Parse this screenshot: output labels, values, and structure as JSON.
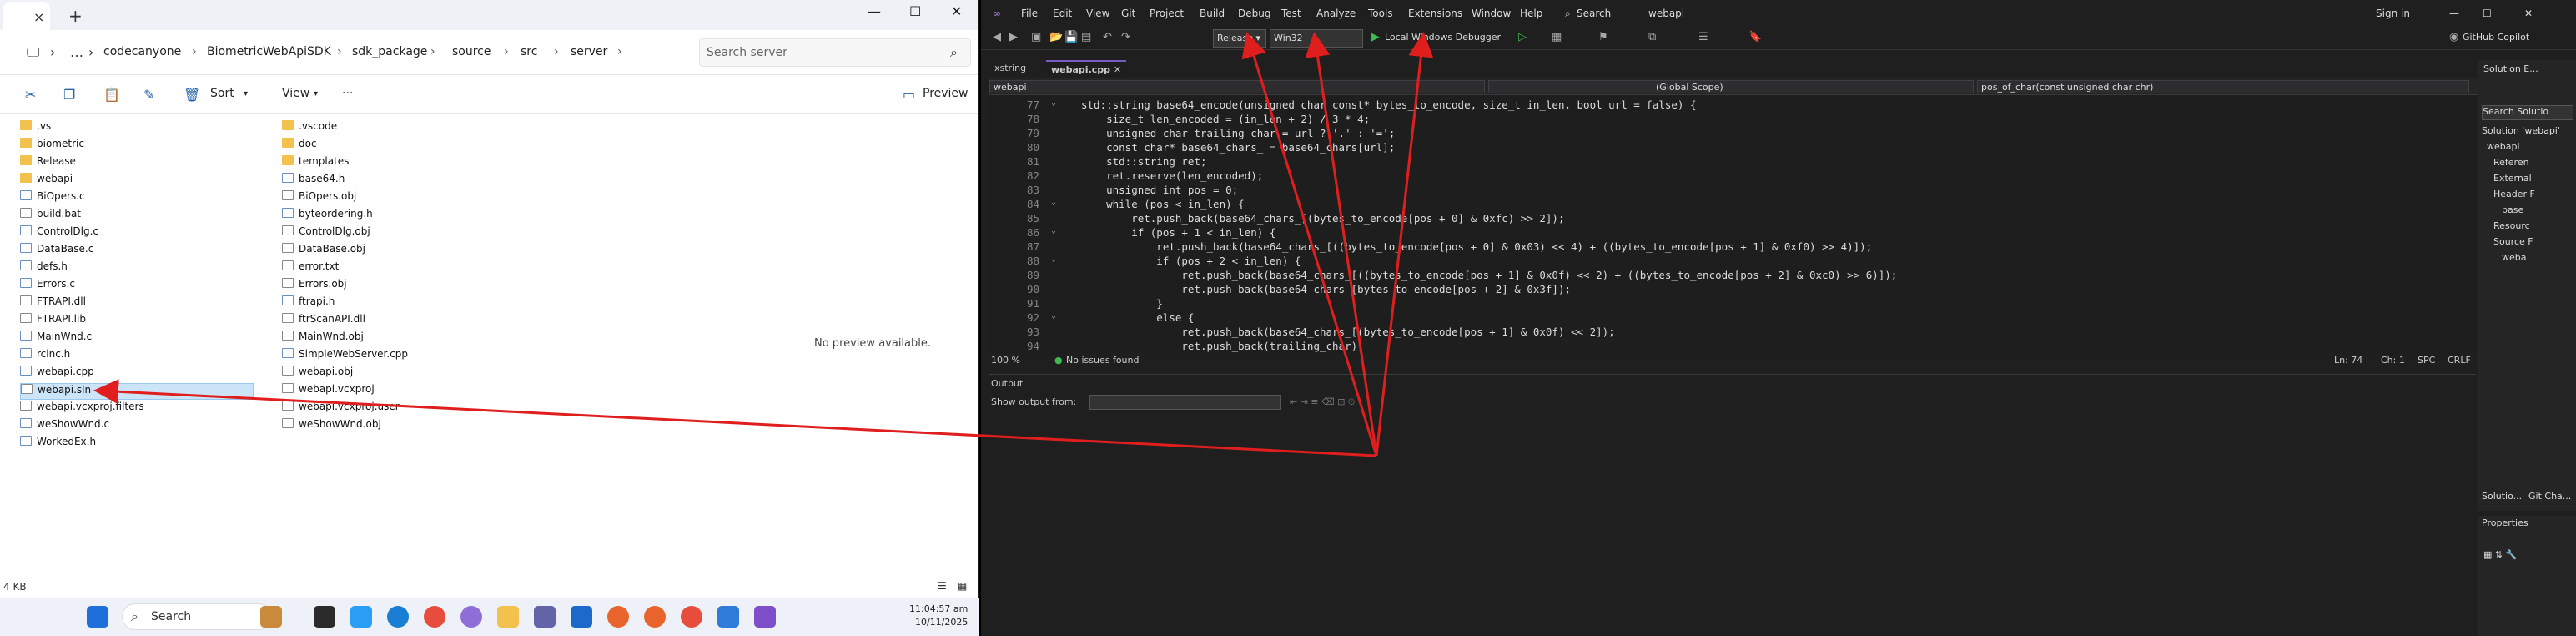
{
  "explorer": {
    "tab_close": "×",
    "tab_add": "+",
    "breadcrumb": [
      "codecanyone",
      "BiometricWebApiSDK",
      "sdk_package",
      "source",
      "src",
      "server"
    ],
    "search_placeholder": "Search server",
    "commands": {
      "sort": "Sort",
      "view": "View",
      "more": "···",
      "preview": "Preview"
    },
    "files_col1": [
      {
        "name": ".vs",
        "kind": "folder"
      },
      {
        "name": "biometric",
        "kind": "folder"
      },
      {
        "name": "Release",
        "kind": "folder"
      },
      {
        "name": "webapi",
        "kind": "folder"
      },
      {
        "name": "BiOpers.c",
        "kind": "c"
      },
      {
        "name": "build.bat",
        "kind": "g"
      },
      {
        "name": "ControlDlg.c",
        "kind": "c"
      },
      {
        "name": "DataBase.c",
        "kind": "c"
      },
      {
        "name": "defs.h",
        "kind": "c"
      },
      {
        "name": "Errors.c",
        "kind": "c"
      },
      {
        "name": "FTRAPI.dll",
        "kind": "g"
      },
      {
        "name": "FTRAPI.lib",
        "kind": "g"
      },
      {
        "name": "MainWnd.c",
        "kind": "c"
      },
      {
        "name": "rclnc.h",
        "kind": "c"
      },
      {
        "name": "webapi.cpp",
        "kind": "c"
      },
      {
        "name": "webapi.sln",
        "kind": "g"
      },
      {
        "name": "webapi.vcxproj.filters",
        "kind": "g"
      },
      {
        "name": "weShowWnd.c",
        "kind": "c"
      },
      {
        "name": "WorkedEx.h",
        "kind": "c"
      }
    ],
    "files_col2": [
      {
        "name": ".vscode",
        "kind": "folder"
      },
      {
        "name": "doc",
        "kind": "folder"
      },
      {
        "name": "templates",
        "kind": "folder"
      },
      {
        "name": "base64.h",
        "kind": "c"
      },
      {
        "name": "BiOpers.obj",
        "kind": "g"
      },
      {
        "name": "byteordering.h",
        "kind": "c"
      },
      {
        "name": "ControlDlg.obj",
        "kind": "g"
      },
      {
        "name": "DataBase.obj",
        "kind": "g"
      },
      {
        "name": "error.txt",
        "kind": "g"
      },
      {
        "name": "Errors.obj",
        "kind": "g"
      },
      {
        "name": "ftrapi.h",
        "kind": "c"
      },
      {
        "name": "ftrScanAPI.dll",
        "kind": "g"
      },
      {
        "name": "MainWnd.obj",
        "kind": "g"
      },
      {
        "name": "SimpleWebServer.cpp",
        "kind": "c"
      },
      {
        "name": "webapi.obj",
        "kind": "g"
      },
      {
        "name": "webapi.vcxproj",
        "kind": "g"
      },
      {
        "name": "webapi.vcxproj.user",
        "kind": "g"
      },
      {
        "name": "weShowWnd.obj",
        "kind": "g"
      }
    ],
    "no_preview": "No preview available.",
    "status": "4 KB"
  },
  "taskbar": {
    "search": "Search",
    "time": "11:04:57 am",
    "date": "10/11/2025"
  },
  "vs": {
    "menu": [
      "File",
      "Edit",
      "View",
      "Git",
      "Project",
      "Build",
      "Debug",
      "Test",
      "Analyze",
      "Tools",
      "Extensions",
      "Window",
      "Help",
      "Search",
      "webapi"
    ],
    "sign_in": "Sign in",
    "copilot": "GitHub Copilot",
    "config": "Release",
    "platform": "Win32",
    "debugger": "Local Windows Debugger",
    "tabs": {
      "left": "xstring",
      "active": "webapi.cpp"
    },
    "nav": {
      "project": "webapi",
      "scope": "(Global Scope)",
      "member": "pos_of_char(const unsigned char chr)"
    },
    "code": [
      {
        "n": "77",
        "t": "std::string base64_encode(unsigned char const* bytes_to_encode, size_t in_len, bool url = false) {"
      },
      {
        "n": "78",
        "t": "    size_t len_encoded = (in_len + 2) / 3 * 4;"
      },
      {
        "n": "79",
        "t": "    unsigned char trailing_char = url ? '.' : '=';"
      },
      {
        "n": "80",
        "t": "    const char* base64_chars_ = base64_chars[url];"
      },
      {
        "n": "81",
        "t": "    std::string ret;"
      },
      {
        "n": "82",
        "t": "    ret.reserve(len_encoded);"
      },
      {
        "n": "83",
        "t": "    unsigned int pos = 0;"
      },
      {
        "n": "84",
        "t": "    while (pos < in_len) {"
      },
      {
        "n": "85",
        "t": "        ret.push_back(base64_chars_[(bytes_to_encode[pos + 0] & 0xfc) >> 2]);"
      },
      {
        "n": "86",
        "t": "        if (pos + 1 < in_len) {"
      },
      {
        "n": "87",
        "t": "            ret.push_back(base64_chars_[((bytes_to_encode[pos + 0] & 0x03) << 4) + ((bytes_to_encode[pos + 1] & 0xf0) >> 4)]);"
      },
      {
        "n": "88",
        "t": "            if (pos + 2 < in_len) {"
      },
      {
        "n": "89",
        "t": "                ret.push_back(base64_chars_[((bytes_to_encode[pos + 1] & 0x0f) << 2) + ((bytes_to_encode[pos + 2] & 0xc0) >> 6)]);"
      },
      {
        "n": "90",
        "t": "                ret.push_back(base64_chars_[bytes_to_encode[pos + 2] & 0x3f]);"
      },
      {
        "n": "91",
        "t": "            }"
      },
      {
        "n": "92",
        "t": "            else {"
      },
      {
        "n": "93",
        "t": "                ret.push_back(base64_chars_[(bytes_to_encode[pos + 1] & 0x0f) << 2]);"
      },
      {
        "n": "94",
        "t": "                ret.push_back(trailing_char);"
      }
    ],
    "status": {
      "zoom": "100 %",
      "issues": "No issues found",
      "ln": "Ln: 74",
      "ch": "Ch: 1",
      "spc": "SPC",
      "crlf": "CRLF"
    },
    "output": {
      "title": "Output",
      "show_from": "Show output from:"
    },
    "solution": {
      "title": "Solution E...",
      "search": "Search Solutio",
      "rows": [
        "Solution 'webapi'",
        "webapi",
        "Referen",
        "External",
        "Header F",
        "base",
        "Resourc",
        "Source F",
        "weba"
      ],
      "tabs": [
        "Solutio...",
        "Git Cha..."
      ]
    },
    "properties": {
      "title": "Properties"
    }
  },
  "colors": {
    "arrow": "#e01e1e",
    "vs_bg": "#1f1f1f",
    "explorer_bg": "#ffffff",
    "selection": "#cce4f7"
  }
}
